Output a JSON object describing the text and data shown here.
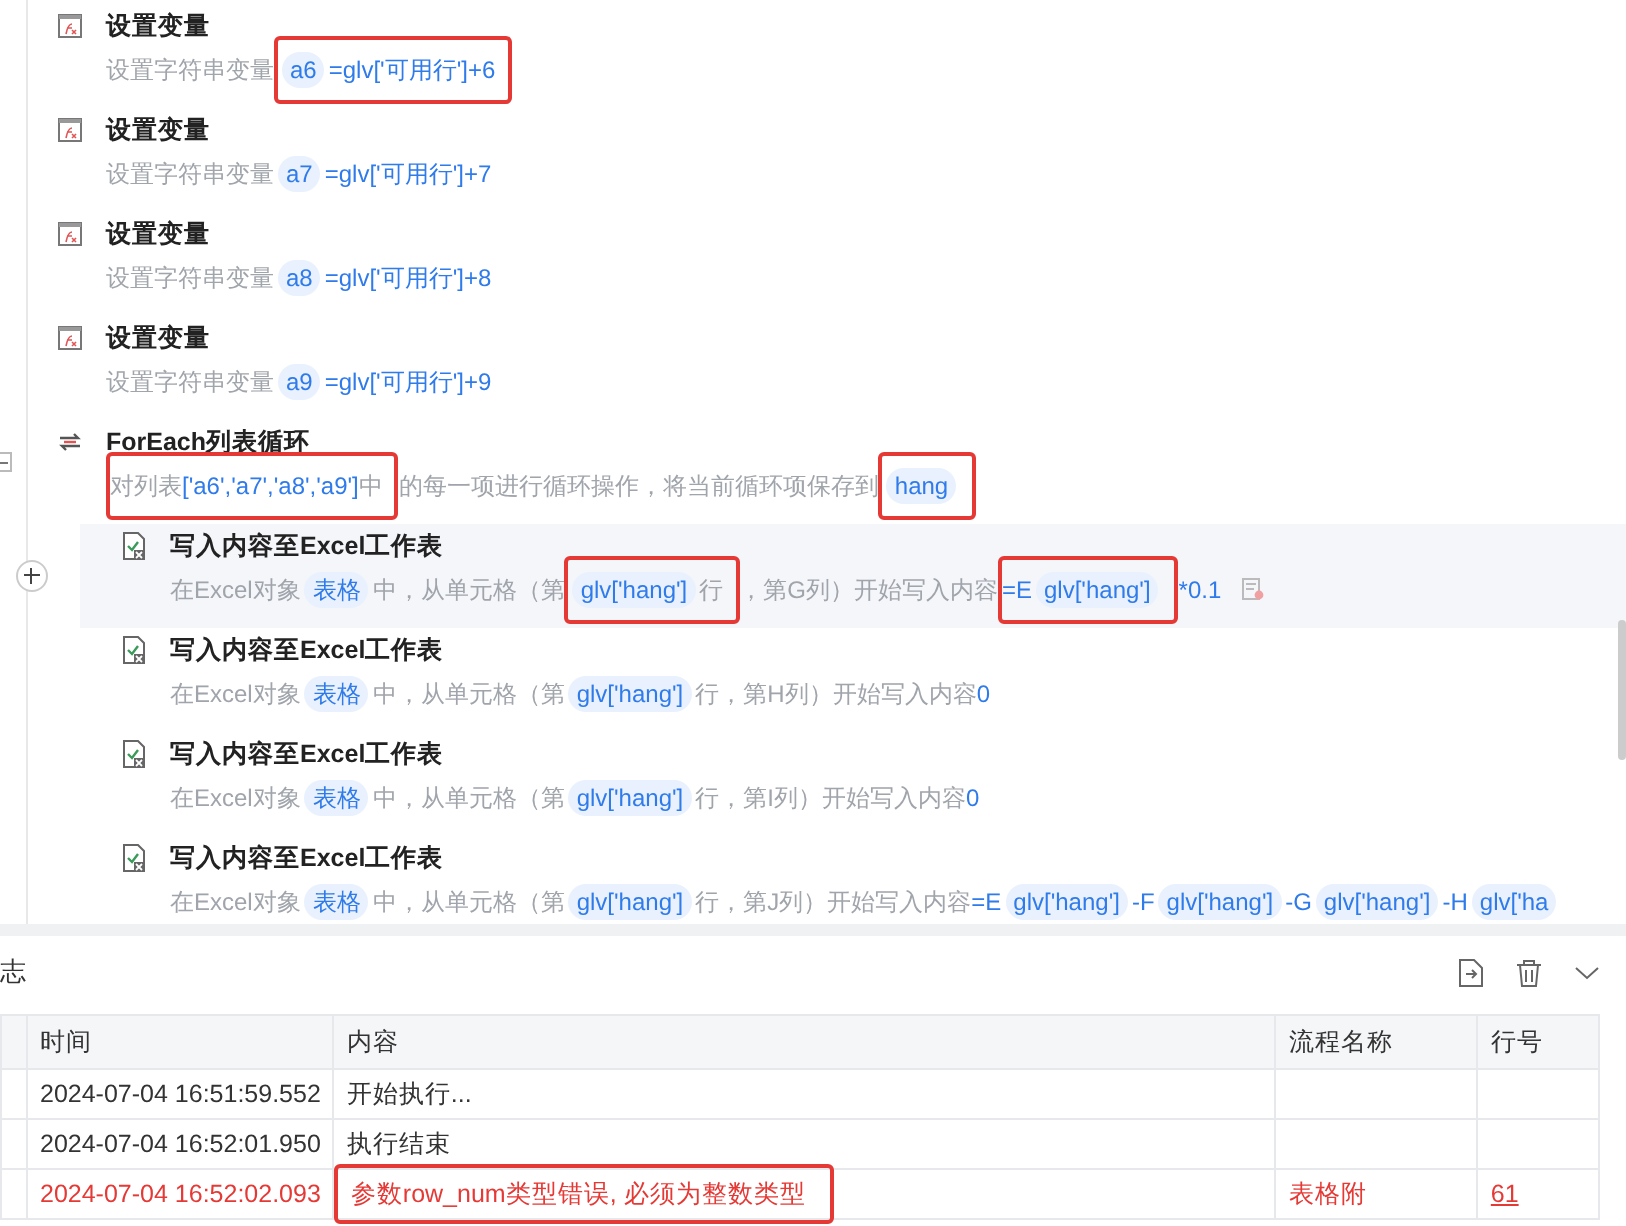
{
  "steps": [
    {
      "kind": "set-var",
      "title": "设置变量",
      "selected": false,
      "description": [
        {
          "kind": "plain",
          "text": "设置字符串变量"
        },
        {
          "kind": "frame",
          "parts": [
            {
              "kind": "token",
              "text": "a6"
            },
            {
              "kind": "code",
              "text": "=glv['可用行']+6"
            }
          ]
        }
      ]
    },
    {
      "kind": "set-var",
      "title": "设置变量",
      "selected": false,
      "description": [
        {
          "kind": "plain",
          "text": "设置字符串变量"
        },
        {
          "kind": "token",
          "text": "a7"
        },
        {
          "kind": "code",
          "text": "=glv['可用行']+7"
        }
      ]
    },
    {
      "kind": "set-var",
      "title": "设置变量",
      "selected": false,
      "description": [
        {
          "kind": "plain",
          "text": "设置字符串变量"
        },
        {
          "kind": "token",
          "text": "a8"
        },
        {
          "kind": "code",
          "text": "=glv['可用行']+8"
        }
      ]
    },
    {
      "kind": "set-var",
      "title": "设置变量",
      "selected": false,
      "description": [
        {
          "kind": "plain",
          "text": "设置字符串变量"
        },
        {
          "kind": "token",
          "text": "a9"
        },
        {
          "kind": "code",
          "text": "=glv['可用行']+9"
        }
      ]
    },
    {
      "kind": "foreach",
      "title": "ForEach列表循环",
      "selected": false,
      "expanded": true,
      "description": [
        {
          "kind": "frame",
          "parts": [
            {
              "kind": "plain",
              "text": "对列表"
            },
            {
              "kind": "code",
              "text": "['a6','a7','a8','a9']"
            },
            {
              "kind": "plain",
              "text": "中"
            }
          ]
        },
        {
          "kind": "plain",
          "text": "的每一项进行循环操作，将当前循环项保存到"
        },
        {
          "kind": "frame",
          "parts": [
            {
              "kind": "token",
              "text": "hang"
            }
          ]
        }
      ],
      "children": [
        {
          "kind": "write-excel",
          "title": "写入内容至Excel工作表",
          "selected": true,
          "description": [
            {
              "kind": "plain",
              "text": "在Excel对象"
            },
            {
              "kind": "token",
              "text": "表格"
            },
            {
              "kind": "plain",
              "text": "中，从单元格（第"
            },
            {
              "kind": "frame",
              "parts": [
                {
                  "kind": "token",
                  "text": "glv['hang']"
                },
                {
                  "kind": "plain",
                  "text": "行"
                }
              ]
            },
            {
              "kind": "plain",
              "text": "，第G列）开始写入内容"
            },
            {
              "kind": "frame",
              "parts": [
                {
                  "kind": "code",
                  "text": "=E"
                },
                {
                  "kind": "token",
                  "text": "glv['hang']"
                }
              ]
            },
            {
              "kind": "code",
              "text": "*0.1"
            },
            {
              "kind": "note"
            }
          ]
        },
        {
          "kind": "write-excel",
          "title": "写入内容至Excel工作表",
          "selected": false,
          "description": [
            {
              "kind": "plain",
              "text": "在Excel对象"
            },
            {
              "kind": "token",
              "text": "表格"
            },
            {
              "kind": "plain",
              "text": "中，从单元格（第"
            },
            {
              "kind": "token",
              "text": "glv['hang']"
            },
            {
              "kind": "plain",
              "text": "行，第H列）开始写入内容"
            },
            {
              "kind": "code",
              "text": "0"
            }
          ]
        },
        {
          "kind": "write-excel",
          "title": "写入内容至Excel工作表",
          "selected": false,
          "description": [
            {
              "kind": "plain",
              "text": "在Excel对象"
            },
            {
              "kind": "token",
              "text": "表格"
            },
            {
              "kind": "plain",
              "text": "中，从单元格（第"
            },
            {
              "kind": "token",
              "text": "glv['hang']"
            },
            {
              "kind": "plain",
              "text": "行，第I列）开始写入内容"
            },
            {
              "kind": "code",
              "text": "0"
            }
          ]
        },
        {
          "kind": "write-excel",
          "title": "写入内容至Excel工作表",
          "selected": false,
          "description": [
            {
              "kind": "plain",
              "text": "在Excel对象"
            },
            {
              "kind": "token",
              "text": "表格"
            },
            {
              "kind": "plain",
              "text": "中，从单元格（第"
            },
            {
              "kind": "token",
              "text": "glv['hang']"
            },
            {
              "kind": "plain",
              "text": "行，第J列）开始写入内容"
            },
            {
              "kind": "code",
              "text": "=E"
            },
            {
              "kind": "token",
              "text": "glv['hang']"
            },
            {
              "kind": "code",
              "text": "-F"
            },
            {
              "kind": "token",
              "text": "glv['hang']"
            },
            {
              "kind": "code",
              "text": "-G"
            },
            {
              "kind": "token",
              "text": "glv['hang']"
            },
            {
              "kind": "code",
              "text": "-H"
            },
            {
              "kind": "token",
              "text": "glv['ha"
            }
          ]
        }
      ]
    }
  ],
  "log_panel": {
    "tab_label": "志",
    "columns": [
      "时间",
      "内容",
      "流程名称",
      "行号"
    ],
    "rows": [
      {
        "kind": "info",
        "time": "2024-07-04 16:51:59.552",
        "content": "开始执行...",
        "content_framed": false
      },
      {
        "kind": "info",
        "time": "2024-07-04 16:52:01.950",
        "content": "执行结束",
        "content_framed": false
      },
      {
        "kind": "error",
        "time": "2024-07-04 16:52:02.093",
        "content": "参数row_num类型错误, 必须为整数类型",
        "content_framed": true,
        "flow": "表格附",
        "line": "61"
      }
    ]
  }
}
